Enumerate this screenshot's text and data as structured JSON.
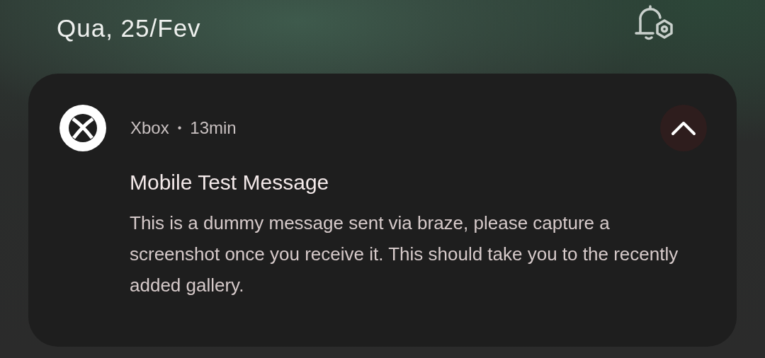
{
  "date": "Qua, 25/Fev",
  "notification": {
    "app": "Xbox",
    "separator": "•",
    "time": "13min",
    "expanded": true,
    "title": "Mobile Test Message",
    "body": "This is a dummy message sent via braze, please capture a screenshot once you receive it. This should take you to the recently added gallery."
  }
}
